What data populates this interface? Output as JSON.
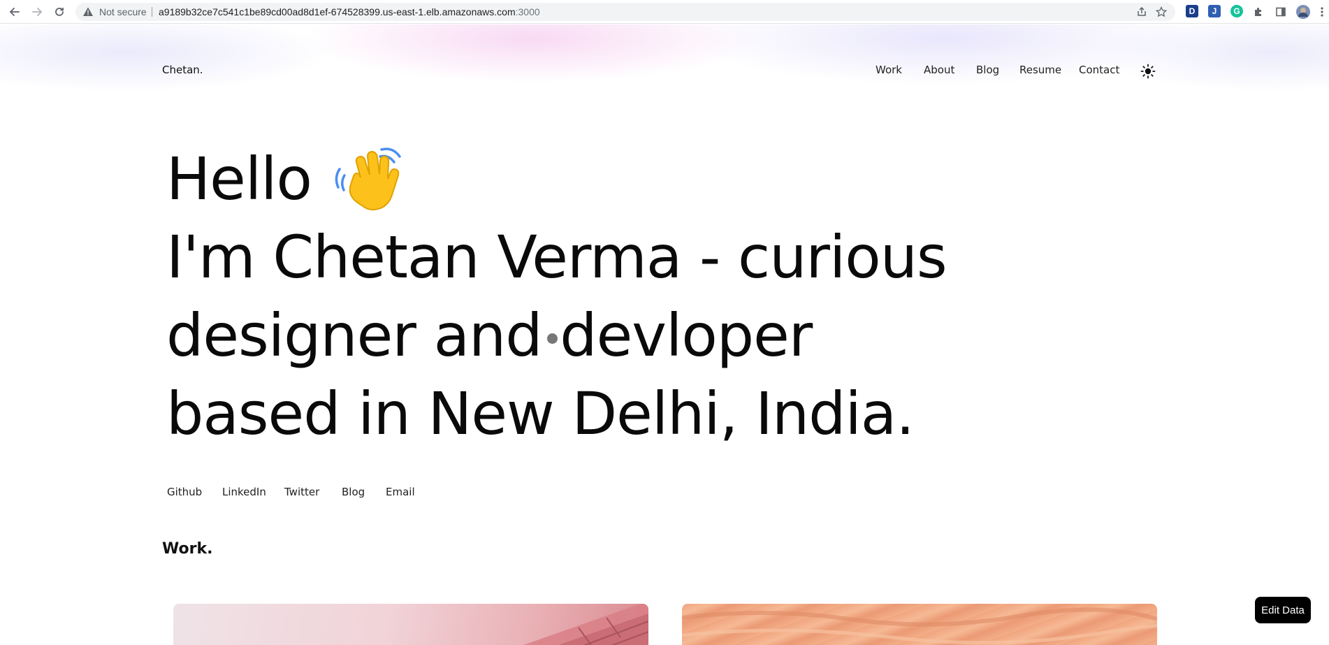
{
  "browser": {
    "security_label": "Not secure",
    "url_host": "a9189b32ce7c541c1be89cd00ad8d1ef-674528399.us-east-1.elb.amazonaws.com",
    "url_port": ":3000",
    "extensions": [
      {
        "letter": "D",
        "color": "#1a3e8c"
      },
      {
        "letter": "J",
        "color": "#2f5fb3"
      },
      {
        "letter": "G",
        "color": "#15c39a"
      }
    ]
  },
  "site": {
    "logo": "Chetan.",
    "nav": [
      "Work",
      "About",
      "Blog",
      "Resume",
      "Contact"
    ]
  },
  "hero": {
    "line1": "Hello",
    "line2": "I'm Chetan Verma - curious",
    "line3": "designer and devloper",
    "line4": "based in New Delhi, India."
  },
  "social": [
    "Github",
    "LinkedIn",
    "Twitter",
    "Blog",
    "Email"
  ],
  "work": {
    "section_title": "Work."
  },
  "edit_button": "Edit Data",
  "colors": {
    "accent_glow_pink": "#f6cdf0",
    "accent_glow_lavender": "#e1def8",
    "button_bg": "#000000"
  }
}
